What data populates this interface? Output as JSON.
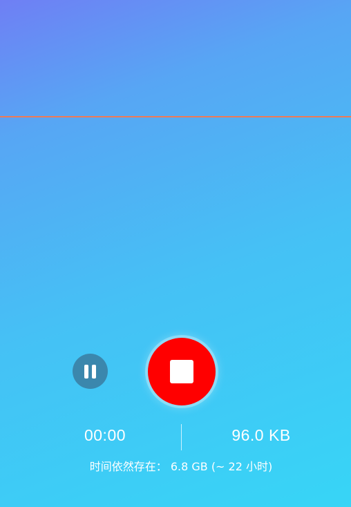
{
  "recorder": {
    "elapsed_time": "00:00",
    "file_size": "96.0 KB",
    "storage_info": "时间依然存在： 6.8 GB (~ 22 小时)"
  },
  "controls": {
    "pause_icon": "pause-icon",
    "stop_icon": "stop-icon"
  },
  "colors": {
    "gradient_top": "#6f7ff4",
    "gradient_bottom": "#37d5f6",
    "waveform_line": "#ee7a56",
    "pause_button": "#3b87ad",
    "stop_button": "#ff0000"
  }
}
